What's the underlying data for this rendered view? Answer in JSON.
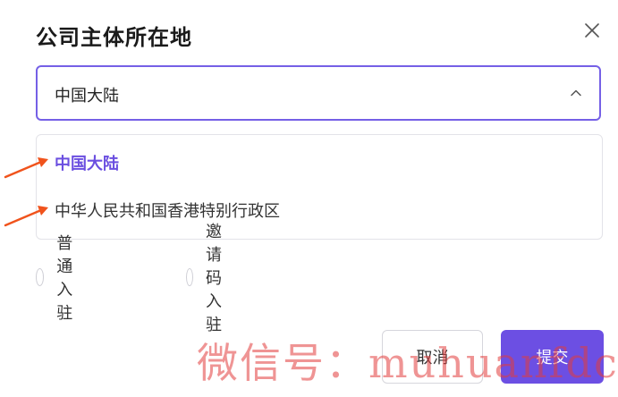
{
  "dialog": {
    "title": "公司主体所在地",
    "close_icon": "close-icon"
  },
  "select": {
    "value": "中国大陆",
    "chevron_icon": "chevron-up-icon"
  },
  "dropdown": {
    "options": [
      {
        "label": "中国大陆",
        "selected": true
      },
      {
        "label": "中华人民共和国香港特别行政区",
        "selected": false
      }
    ]
  },
  "annotations": {
    "arrow_icon": "arrow-pointer-icon",
    "arrow_color": "#f0531c"
  },
  "radios": [
    {
      "label": "普通入驻",
      "checked": false
    },
    {
      "label": "邀请码入驻",
      "checked": false
    }
  ],
  "actions": {
    "cancel_label": "取消",
    "submit_label": "提交"
  },
  "colors": {
    "accent": "#6c4fe3",
    "selected_text": "#6b4fe0",
    "watermark": "#e23c3c"
  },
  "watermark": {
    "text": "微信号：muhuanfdc"
  }
}
